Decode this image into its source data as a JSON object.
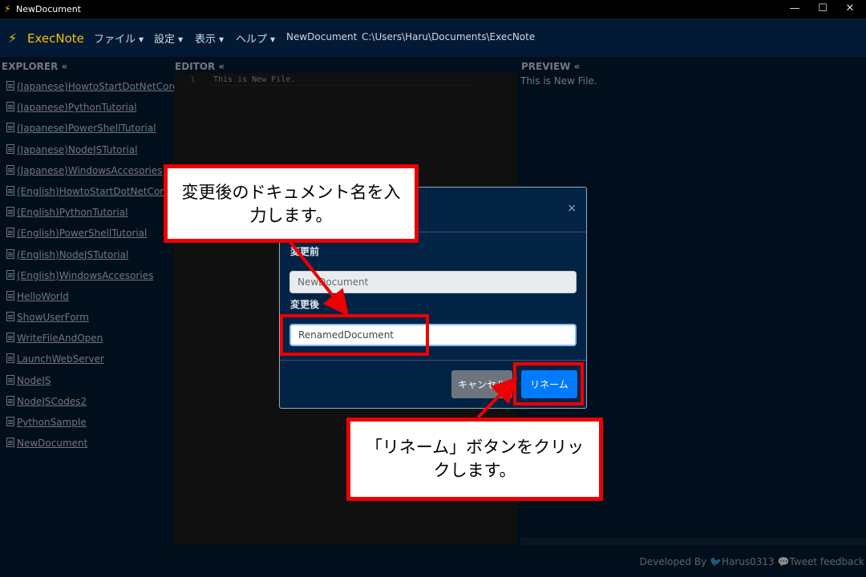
{
  "window": {
    "title": "NewDocument",
    "minimize": "—",
    "maximize": "☐",
    "close": "✕"
  },
  "navbar": {
    "brand": "ExecNote",
    "menus": [
      "ファイル",
      "設定",
      "表示",
      "ヘルプ"
    ],
    "doc_name": "NewDocument",
    "path": "C:\\Users\\Haru\\Documents\\ExecNote"
  },
  "explorer": {
    "title": "EXPLORER «",
    "files": [
      "(Japanese)HowtoStartDotNetCore",
      "(Japanese)PythonTutorial",
      "(Japanese)PowerShellTutorial",
      "(Japanese)NodeJSTutorial",
      "(Japanese)WindowsAccesories",
      "(English)HowtoStartDotNetCore",
      "(English)PythonTutorial",
      "(English)PowerShellTutorial",
      "(English)NodeJSTutorial",
      "(English)WindowsAccesories",
      "HelloWorld",
      "ShowUserForm",
      "WriteFileAndOpen",
      "LaunchWebServer",
      "NodeJS",
      "NodeJSCodes2",
      "PythonSample",
      "NewDocument"
    ]
  },
  "editor": {
    "title": "EDITOR «",
    "line_number": "1",
    "content": "This is New File."
  },
  "preview": {
    "title": "PREVIEW «",
    "content": "This is New File."
  },
  "footer": {
    "text": "Developed By 🐦Harus0313 💬Tweet feedback"
  },
  "modal": {
    "close": "×",
    "before_label": "変更前",
    "before_value": "NewDocument",
    "after_label": "変更後",
    "after_value": "RenamedDocument",
    "cancel_label": "キャンセル",
    "rename_label": "リネーム"
  },
  "annotations": {
    "input_callout": "変更後のドキュメント名を入力します。",
    "button_callout": "「リネーム」ボタンをクリックします。",
    "color": "#e00000"
  }
}
